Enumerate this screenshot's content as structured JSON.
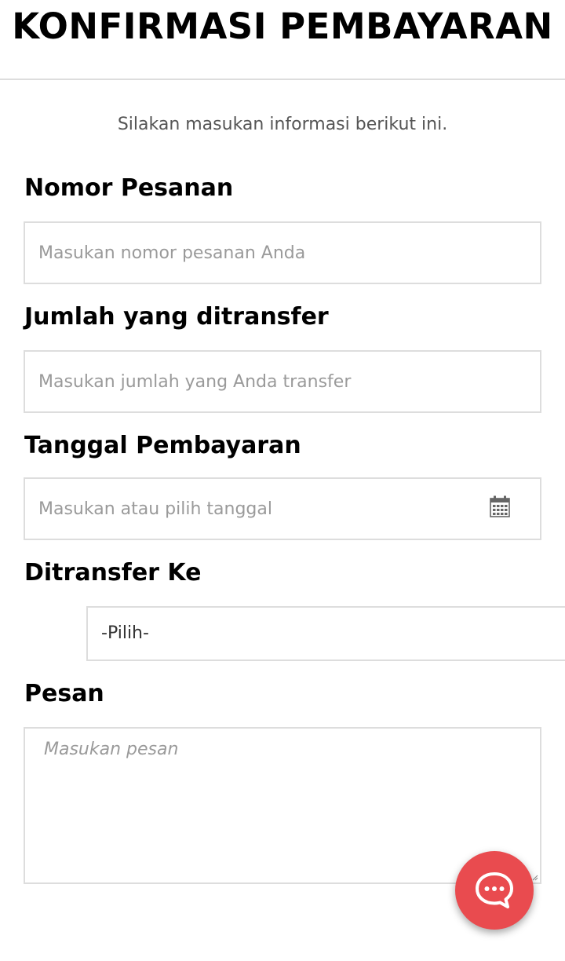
{
  "header": {
    "title": "KONFIRMASI PEMBAYARAN"
  },
  "intro": "Silakan masukan informasi berikut ini.",
  "form": {
    "order_number": {
      "label": "Nomor Pesanan",
      "placeholder": "Masukan nomor pesanan Anda",
      "value": ""
    },
    "amount": {
      "label": "Jumlah yang ditransfer",
      "placeholder": "Masukan jumlah yang Anda transfer",
      "value": ""
    },
    "payment_date": {
      "label": "Tanggal Pembayaran",
      "placeholder": "Masukan atau pilih tanggal",
      "value": "",
      "icon": "calendar-icon"
    },
    "transfer_to": {
      "label": "Ditransfer Ke",
      "selected": "-Pilih-"
    },
    "message": {
      "label": "Pesan",
      "placeholder": "Masukan pesan",
      "value": ""
    }
  },
  "chat_button": {
    "icon": "chat-bubble-icon",
    "color": "#e94b4f"
  },
  "colors": {
    "border": "#dddddd",
    "placeholder": "#9a9a9a",
    "intro_text": "#555555"
  }
}
